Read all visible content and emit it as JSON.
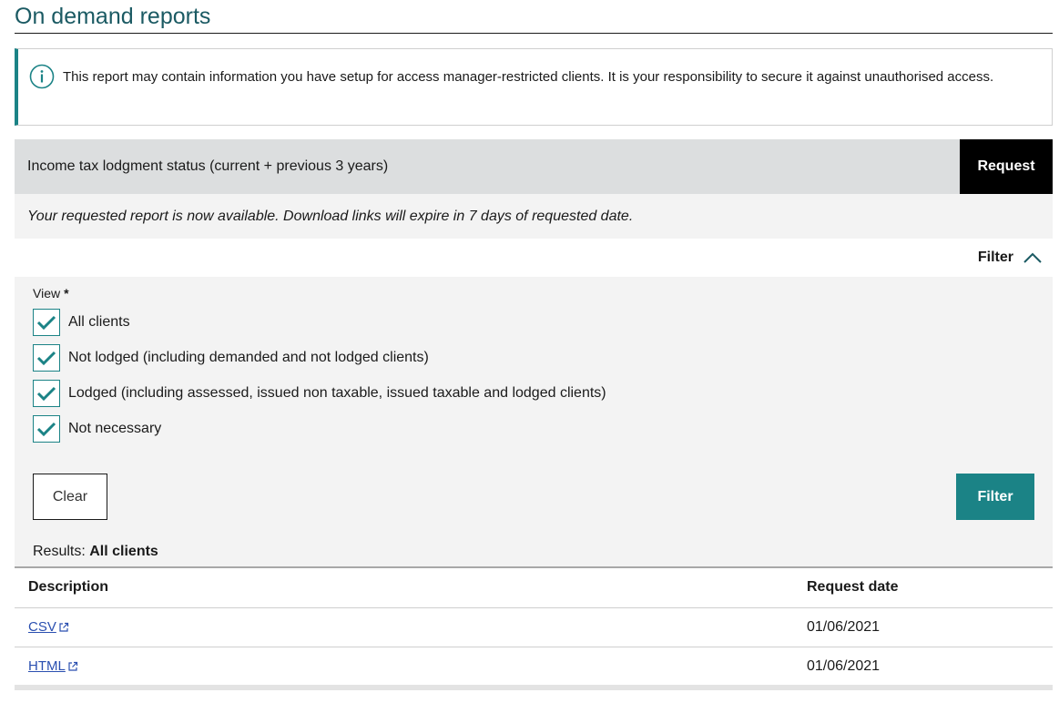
{
  "page": {
    "title": "On demand reports"
  },
  "info": {
    "text": "This report may contain information you have setup for access manager-restricted clients. It is your responsibility to secure it against unauthorised access."
  },
  "report": {
    "name": "Income tax lodgment status (current + previous 3 years)",
    "request_label": "Request"
  },
  "notice": {
    "text": "Your requested report is now available. Download links will expire in 7 days of requested date."
  },
  "filter": {
    "toggle_label": "Filter",
    "view_label": "View",
    "required_marker": "*",
    "options": [
      {
        "label": "All clients",
        "checked": true
      },
      {
        "label": "Not lodged (including demanded and not lodged clients)",
        "checked": true
      },
      {
        "label": "Lodged (including assessed, issued non taxable, issued taxable and lodged clients)",
        "checked": true
      },
      {
        "label": "Not necessary",
        "checked": true
      }
    ],
    "clear_label": "Clear",
    "filter_label": "Filter",
    "results_label": "Results:",
    "results_value": "All clients"
  },
  "table": {
    "headers": {
      "description": "Description",
      "request_date": "Request date"
    },
    "rows": [
      {
        "description": "CSV",
        "request_date": "01/06/2021"
      },
      {
        "description": "HTML",
        "request_date": "01/06/2021"
      }
    ]
  },
  "colors": {
    "accent": "#1b8386",
    "title": "#1b5a63",
    "link": "#2a4fb0",
    "bar": "#dcdedf",
    "panel": "#f3f3f3"
  },
  "icons": {
    "info": "info-circle-icon",
    "chevron": "chevron-up-icon",
    "check": "checkmark-icon",
    "external": "external-link-icon"
  }
}
